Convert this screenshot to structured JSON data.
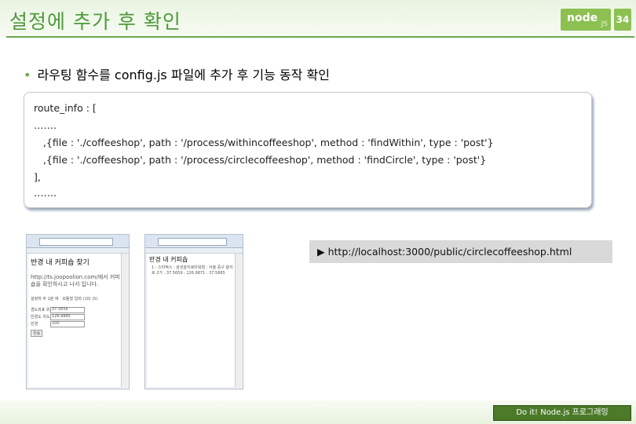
{
  "header": {
    "title": "설정에 추가 후 확인",
    "logo_text": "node",
    "logo_suffix": "JS",
    "page_number": "34"
  },
  "bullet": {
    "marker": "•",
    "text": "라우팅 함수를 config.js 파일에 추가 후 기능 동작 확인"
  },
  "code": {
    "lines": [
      "route_info : [",
      "…….",
      "   ,{file : './coffeeshop', path : '/process/withincoffeeshop', method : 'findWithin', type : 'post'}",
      "   ,{file : './coffeeshop', path : '/process/circlecoffeeshop', method : 'findCircle', type : 'post'}",
      "],",
      "……."
    ]
  },
  "screenshot_left": {
    "heading": "반경 내 커피숍 찾기",
    "description": "http://ts.joopoolion.com/에서 커피숍을 확인하시고 나서 입니다.",
    "note": "설정하 주 1분 에 · 모듈형 입력 (10) (5)",
    "fields": [
      {
        "label": "경도좌표 위도",
        "value": "37.5656"
      },
      {
        "label": "반경도 위도",
        "value": "126.9885"
      },
      {
        "label": "반경",
        "value": "100"
      }
    ],
    "button": "전송"
  },
  "screenshot_right": {
    "heading": "반경 내 커피숍",
    "item": "1 : 스타벅스 : 삼성을지로타워점 : 서울 중구 을지로 2가 : 37.5659 : 126.9871 : 37.5665"
  },
  "url_note": {
    "marker": "▶",
    "url": "http://localhost:3000/public/circlecoffeeshop.html"
  },
  "footer": {
    "badge": "Do it! Node.js 프로그래밍"
  },
  "colors": {
    "title_green": "#4e9a3a",
    "logo_green": "#8cc152",
    "footer_green": "#4b7a28",
    "url_box_gray": "#d9d9d9"
  }
}
